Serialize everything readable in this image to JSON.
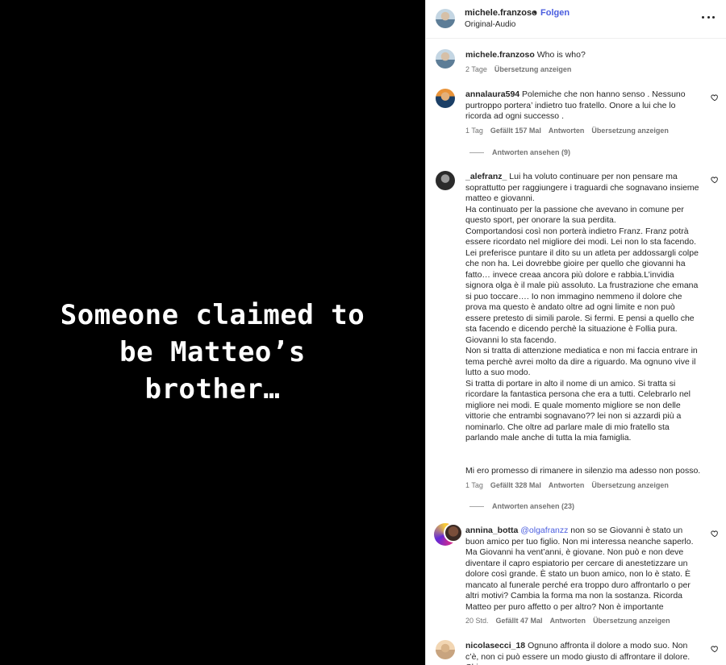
{
  "media": {
    "caption": "Someone claimed to\nbe Matteo’s\nbrother…"
  },
  "header": {
    "username": "michele.franzoso",
    "separator": "•",
    "follow_label": "Folgen",
    "subtitle": "Original-Audio",
    "more_icon": "more-horizontal-icon"
  },
  "post_caption": {
    "username": "michele.franzoso",
    "text": "Who is who?",
    "time": "2 Tage",
    "translate": "Übersetzung anzeigen"
  },
  "comments": [
    {
      "username": "annalaura594",
      "text": "Polemiche che non hanno senso . Nessuno purtroppo portera’ indietro tuo fratello. Onore a lui che lo ricorda ad ogni successo .",
      "time": "1 Tag",
      "likes": "Gefällt 157 Mal",
      "reply": "Antworten",
      "translate": "Übersetzung anzeigen",
      "replies": "Antworten ansehen (9)"
    },
    {
      "username": "_alefranz_",
      "text": "Lui ha voluto continuare per non pensare ma soprattutto per raggiungere i traguardi che sognavano insieme matteo e giovanni.\nHa continuato per la passione che avevano in comune per questo sport, per onorare la sua perdita.\nComportandosi così non porterà indietro Franz. Franz potrà essere ricordato nel migliore dei modi. Lei non lo sta facendo. Lei preferisce puntare il dito su un atleta per addossargli colpe che non ha. Lei dovrebbe gioire per quello che giovanni ha fatto… invece creaa ancora più dolore e rabbia.L’invidia signora olga è il male più assoluto. La frustrazione che emana si puo toccare…. Io non immagino nemmeno il dolore che prova ma questo è andato oltre ad ogni limite e non può essere pretesto di simili parole. Si fermi. E pensi a quello che sta facendo e dicendo perchè la situazione è Follia pura.\nGiovanni lo sta facendo.\nNon si tratta di attenzione mediatica e non mi faccia entrare in tema perchè avrei molto da dire a riguardo. Ma ognuno vive il lutto a suo modo.\nSi tratta di portare in alto il nome di un amico. Si tratta si ricordare la fantastica persona che era a tutti. Celebrarlo nel migliore nei modi. E quale momento migliore se non delle vittorie che entrambi sognavano?? lei non si azzardi più a nominarlo. Che oltre ad parlare male di mio fratello sta parlando male anche di tutta la mia famiglia.\n\n\nMi ero promesso di rimanere in silenzio ma adesso non posso.",
      "time": "1 Tag",
      "likes": "Gefällt 328 Mal",
      "reply": "Antworten",
      "translate": "Übersetzung anzeigen",
      "replies": "Antworten ansehen (23)"
    },
    {
      "username": "annina_botta",
      "mention": "@olgafranzz",
      "text": "non so se Giovanni è stato un buon amico per tuo figlio. Non mi interessa neanche saperlo. Ma Giovanni ha vent’anni, è giovane. Non può e non deve diventare il capro espiatorio per cercare di anestetizzare un dolore così grande. È stato un buon amico, non lo è stato. È mancato al funerale perché era troppo duro affrontarlo o per altri motivi? Cambia la forma ma non la sostanza. Ricorda Matteo per puro affetto o per altro? Non è importante",
      "time": "20 Std.",
      "likes": "Gefällt 47 Mal",
      "reply": "Antworten",
      "translate": "Übersetzung anzeigen"
    },
    {
      "username": "nicolasecci_18",
      "text": "Ognuno affronta il dolore a modo suo. Non c’è, non ci può essere un modo giusto di affrontare il dolore. Chi"
    }
  ],
  "colors": {
    "link": "#4a5ddf",
    "meta": "#737373",
    "text": "#262626"
  },
  "icons": {
    "like": "heart-outline-icon"
  }
}
